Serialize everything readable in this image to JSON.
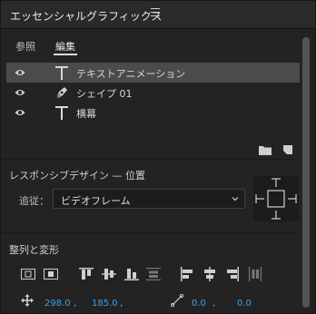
{
  "header": {
    "title": "エッセンシャルグラフィックス",
    "menu_icon": "hamburger-menu-icon"
  },
  "tabs": [
    {
      "label": "参照",
      "active": false
    },
    {
      "label": "編集",
      "active": true
    }
  ],
  "layers": [
    {
      "name": "テキストアニメーション",
      "icon": "text-layer-icon",
      "selected": true
    },
    {
      "name": "シェイプ 01",
      "icon": "pen-shape-icon",
      "selected": false
    },
    {
      "name": "横幕",
      "icon": "text-layer-icon",
      "selected": false
    }
  ],
  "layer_actions": {
    "folder_icon": "new-folder-icon",
    "new_item_icon": "new-layer-icon"
  },
  "responsive": {
    "title": "レスポンシブデザイン — 位置",
    "follow_label": "追従：",
    "follow_value": "ビデオフレーム"
  },
  "align": {
    "title": "整列と変形"
  },
  "transform": {
    "position_x": "298.0",
    "position_y": "185.0",
    "anchor_x": "0.0",
    "anchor_y": "0.0"
  },
  "colors": {
    "accent": "#3aa0ee",
    "selected_row": "#4b4b4b",
    "panel_bg": "#232323"
  }
}
